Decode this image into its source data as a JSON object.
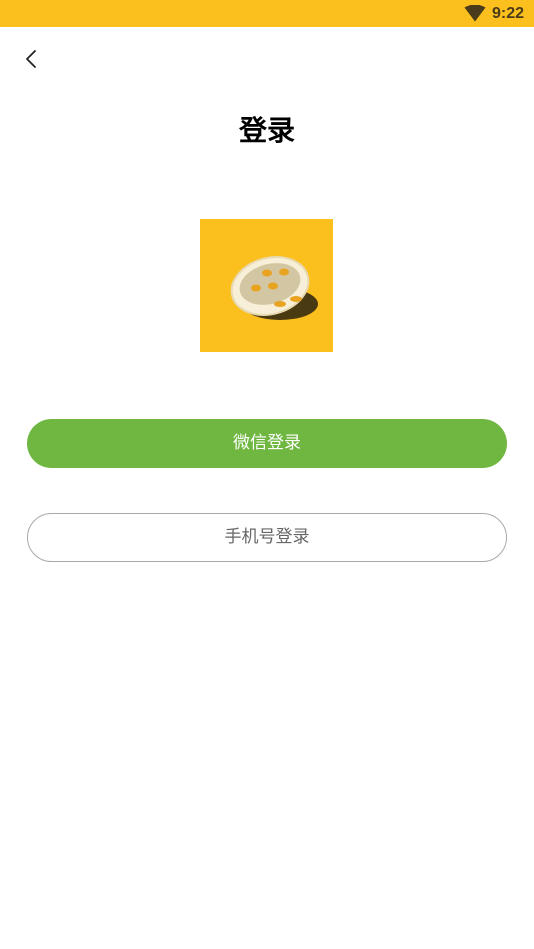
{
  "status_bar": {
    "time": "9:22",
    "wifi_icon": "wifi-icon",
    "background_color": "#fbbf1e"
  },
  "header": {
    "back_icon": "chevron-left-icon",
    "title": "登录"
  },
  "logo": {
    "icon": "button-logo-icon",
    "background_color": "#fbbf1e"
  },
  "actions": {
    "wechat_login_label": "微信登录",
    "wechat_color": "#6fb741",
    "phone_login_label": "手机号登录"
  }
}
